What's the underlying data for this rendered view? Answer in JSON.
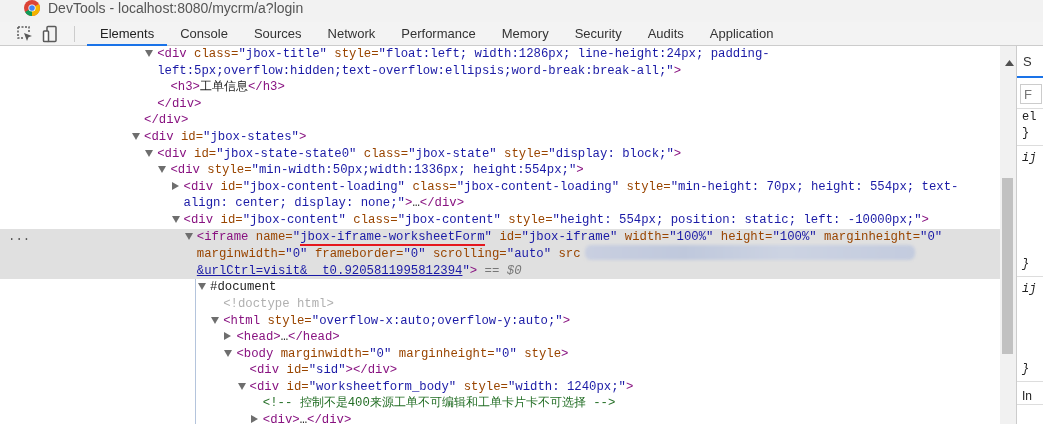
{
  "window": {
    "title": "DevTools - localhost:8080/mycrm/a?login"
  },
  "tabs": [
    {
      "label": "Elements",
      "selected": true
    },
    {
      "label": "Console",
      "selected": false
    },
    {
      "label": "Sources",
      "selected": false
    },
    {
      "label": "Network",
      "selected": false
    },
    {
      "label": "Performance",
      "selected": false
    },
    {
      "label": "Memory",
      "selected": false
    },
    {
      "label": "Security",
      "selected": false
    },
    {
      "label": "Audits",
      "selected": false
    },
    {
      "label": "Application",
      "selected": false
    }
  ],
  "tree": [
    {
      "children": [
        {
          "expanded": true,
          "selected": false,
          "open": [
            {
              "kind": "tag",
              "text": "<div"
            },
            {
              "kind": "attr",
              "text": " class="
            },
            {
              "kind": "value",
              "text": "\"jbox-title\""
            },
            {
              "kind": "attr",
              "text": " style="
            },
            {
              "kind": "value",
              "text": "\"float:left; width:1286px; line-height:24px; padding-left:5px;overflow:hidden;text-overflow:ellipsis;word-break:break-all;\""
            },
            {
              "kind": "tag",
              "text": ">"
            }
          ],
          "children": [
            {
              "selected": false,
              "open": [
                {
                  "kind": "tag",
                  "text": "<h3>"
                },
                {
                  "kind": "text",
                  "text": "工单信息"
                },
                {
                  "kind": "tag",
                  "text": "</h3>"
                }
              ]
            }
          ],
          "close": [
            {
              "kind": "tag",
              "text": "</div>"
            }
          ]
        }
      ],
      "close": [
        {
          "kind": "tag",
          "text": "</div>"
        }
      ]
    },
    {
      "expanded": true,
      "selected": false,
      "open": [
        {
          "kind": "tag",
          "text": "<div"
        },
        {
          "kind": "attr",
          "text": " id="
        },
        {
          "kind": "value",
          "text": "\"jbox-states\""
        },
        {
          "kind": "tag",
          "text": ">"
        }
      ],
      "children": [
        {
          "expanded": true,
          "selected": false,
          "open": [
            {
              "kind": "tag",
              "text": "<div"
            },
            {
              "kind": "attr",
              "text": " id="
            },
            {
              "kind": "value",
              "text": "\"jbox-state-state0\""
            },
            {
              "kind": "attr",
              "text": " class="
            },
            {
              "kind": "value",
              "text": "\"jbox-state\""
            },
            {
              "kind": "attr",
              "text": " style="
            },
            {
              "kind": "value",
              "text": "\"display: block;\""
            },
            {
              "kind": "tag",
              "text": ">"
            }
          ],
          "children": [
            {
              "expanded": true,
              "selected": false,
              "open": [
                {
                  "kind": "tag",
                  "text": "<div"
                },
                {
                  "kind": "attr",
                  "text": " style="
                },
                {
                  "kind": "value",
                  "text": "\"min-width:50px;width:1336px; height:554px;\""
                },
                {
                  "kind": "tag",
                  "text": ">"
                }
              ],
              "children": [
                {
                  "expanded": false,
                  "selected": false,
                  "open": [
                    {
                      "kind": "tag",
                      "text": "<div"
                    },
                    {
                      "kind": "attr",
                      "text": " id="
                    },
                    {
                      "kind": "value",
                      "text": "\"jbox-content-loading\""
                    },
                    {
                      "kind": "attr",
                      "text": " class="
                    },
                    {
                      "kind": "value",
                      "text": "\"jbox-content-loading\""
                    },
                    {
                      "kind": "attr",
                      "text": " style="
                    },
                    {
                      "kind": "value",
                      "text": "\"min-height: 70px; height: 554px; text-align: center; display: none;\""
                    },
                    {
                      "kind": "tag",
                      "text": ">"
                    },
                    {
                      "kind": "text",
                      "text": "…"
                    },
                    {
                      "kind": "tag",
                      "text": "</div>"
                    }
                  ]
                },
                {
                  "expanded": true,
                  "selected": false,
                  "open": [
                    {
                      "kind": "tag",
                      "text": "<div"
                    },
                    {
                      "kind": "attr",
                      "text": " id="
                    },
                    {
                      "kind": "value",
                      "text": "\"jbox-content\""
                    },
                    {
                      "kind": "attr",
                      "text": " class="
                    },
                    {
                      "kind": "value",
                      "text": "\"jbox-content\""
                    },
                    {
                      "kind": "attr",
                      "text": " style="
                    },
                    {
                      "kind": "value",
                      "text": "\"height: 554px; position: static; left: -10000px;\""
                    },
                    {
                      "kind": "tag",
                      "text": ">"
                    }
                  ],
                  "children": [
                    {
                      "expanded": true,
                      "selected": true,
                      "menu": "...",
                      "open": [
                        {
                          "kind": "tag",
                          "text": "<iframe"
                        },
                        {
                          "kind": "attr",
                          "text": " name="
                        },
                        {
                          "kind": "value",
                          "text": "\""
                        },
                        {
                          "kind": "value",
                          "text": "jbox-iframe-worksheetForm",
                          "annotated": true
                        },
                        {
                          "kind": "value",
                          "text": "\""
                        },
                        {
                          "kind": "attr",
                          "text": " id="
                        },
                        {
                          "kind": "value",
                          "text": "\"jbox-iframe\""
                        },
                        {
                          "kind": "attr",
                          "text": " width="
                        },
                        {
                          "kind": "value",
                          "text": "\"100%\""
                        },
                        {
                          "kind": "attr",
                          "text": " height="
                        },
                        {
                          "kind": "value",
                          "text": "\"100%\""
                        },
                        {
                          "kind": "attr",
                          "text": " marginheight="
                        },
                        {
                          "kind": "value",
                          "text": "\"0\""
                        },
                        {
                          "kind": "attr",
                          "text": " marginwidth="
                        },
                        {
                          "kind": "value",
                          "text": "\"0\""
                        },
                        {
                          "kind": "attr",
                          "text": " frameborder="
                        },
                        {
                          "kind": "value",
                          "text": "\"0\""
                        },
                        {
                          "kind": "attr",
                          "text": " scrolling="
                        },
                        {
                          "kind": "value",
                          "text": "\"auto\""
                        },
                        {
                          "kind": "attr",
                          "text": " src"
                        },
                        {
                          "kind": "redacted"
                        },
                        {
                          "kind": "link",
                          "text": "&urlCtrl=visit&__t0.9205811995812394"
                        },
                        {
                          "kind": "value",
                          "text": "\""
                        },
                        {
                          "kind": "tag",
                          "text": ">"
                        },
                        {
                          "kind": "hint",
                          "text": " == $0"
                        }
                      ],
                      "children": [
                        {
                          "expanded": true,
                          "selected": false,
                          "open": [
                            {
                              "kind": "text",
                              "text": "#document"
                            }
                          ],
                          "children": [
                            {
                              "selected": false,
                              "open": [
                                {
                                  "kind": "muted",
                                  "text": "<!doctype html>"
                                }
                              ]
                            },
                            {
                              "expanded": true,
                              "selected": false,
                              "open": [
                                {
                                  "kind": "tag",
                                  "text": "<html"
                                },
                                {
                                  "kind": "attr",
                                  "text": " style="
                                },
                                {
                                  "kind": "value",
                                  "text": "\"overflow-x:auto;overflow-y:auto;\""
                                },
                                {
                                  "kind": "tag",
                                  "text": ">"
                                }
                              ],
                              "children": [
                                {
                                  "expanded": false,
                                  "selected": false,
                                  "open": [
                                    {
                                      "kind": "tag",
                                      "text": "<head>"
                                    },
                                    {
                                      "kind": "text",
                                      "text": "…"
                                    },
                                    {
                                      "kind": "tag",
                                      "text": "</head>"
                                    }
                                  ]
                                },
                                {
                                  "expanded": true,
                                  "selected": false,
                                  "open": [
                                    {
                                      "kind": "tag",
                                      "text": "<body"
                                    },
                                    {
                                      "kind": "attr",
                                      "text": " marginwidth="
                                    },
                                    {
                                      "kind": "value",
                                      "text": "\"0\""
                                    },
                                    {
                                      "kind": "attr",
                                      "text": " marginheight="
                                    },
                                    {
                                      "kind": "value",
                                      "text": "\"0\""
                                    },
                                    {
                                      "kind": "attr",
                                      "text": " style"
                                    },
                                    {
                                      "kind": "tag",
                                      "text": ">"
                                    }
                                  ],
                                  "children": [
                                    {
                                      "selected": false,
                                      "open": [
                                        {
                                          "kind": "tag",
                                          "text": "<div"
                                        },
                                        {
                                          "kind": "attr",
                                          "text": " id="
                                        },
                                        {
                                          "kind": "value",
                                          "text": "\"sid\""
                                        },
                                        {
                                          "kind": "tag",
                                          "text": "></div>"
                                        }
                                      ]
                                    },
                                    {
                                      "expanded": true,
                                      "selected": false,
                                      "open": [
                                        {
                                          "kind": "tag",
                                          "text": "<div"
                                        },
                                        {
                                          "kind": "attr",
                                          "text": " id="
                                        },
                                        {
                                          "kind": "value",
                                          "text": "\"worksheetform_body\""
                                        },
                                        {
                                          "kind": "attr",
                                          "text": " style="
                                        },
                                        {
                                          "kind": "value",
                                          "text": "\"width: 1240px;\""
                                        },
                                        {
                                          "kind": "tag",
                                          "text": ">"
                                        }
                                      ],
                                      "children": [
                                        {
                                          "selected": false,
                                          "open": [
                                            {
                                              "kind": "comment",
                                              "text": "<!-- 控制不是400来源工单不可编辑和工单卡片卡不可选择 -->"
                                            }
                                          ]
                                        },
                                        {
                                          "expanded": false,
                                          "selected": false,
                                          "open": [
                                            {
                                              "kind": "tag",
                                              "text": "<div>"
                                            },
                                            {
                                              "kind": "text",
                                              "text": "…"
                                            },
                                            {
                                              "kind": "tag",
                                              "text": "</div>"
                                            }
                                          ]
                                        }
                                      ]
                                    }
                                  ]
                                }
                              ]
                            }
                          ]
                        }
                      ]
                    }
                  ]
                }
              ]
            }
          ]
        }
      ]
    }
  ],
  "sidebar": {
    "tab": "S",
    "filter_placeholder": "F",
    "lines": [
      "el",
      "}",
      "ij",
      "}",
      "ij",
      "}",
      "In"
    ]
  }
}
